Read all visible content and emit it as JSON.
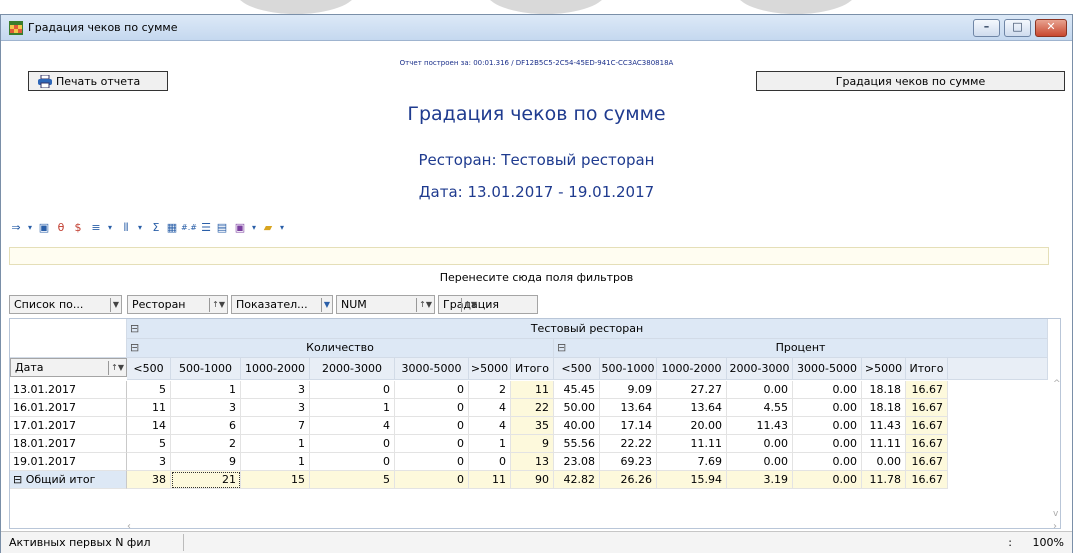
{
  "window": {
    "title": "Градация чеков по сумме",
    "report_info": "Отчет построен за: 00:01.316 / DF12B5C5-2C54-45ED-941C-CC3AC380818A",
    "print_button": "Печать отчета",
    "title_button": "Градация чеков по сумме"
  },
  "report": {
    "heading": "Градация чеков по сумме",
    "restaurant": "Ресторан: Тестовый ресторан",
    "date_range": "Дата: 13.01.2017 - 19.01.2017"
  },
  "pivot": {
    "drop_area_hint": "Перенесите сюда поля фильтров",
    "field_buttons": [
      "Список по...",
      "Ресторан",
      "Показател...",
      "NUM",
      "Градация"
    ],
    "restaurant_header": "Тестовый ресторан",
    "group_headers": [
      "Количество",
      "Процент"
    ],
    "row_field": "Дата",
    "column_headers": [
      "<500",
      "500-1000",
      "1000-2000",
      "2000-3000",
      "3000-5000",
      ">5000",
      "Итого",
      "<500",
      "500-1000",
      "1000-2000",
      "2000-3000",
      "3000-5000",
      ">5000",
      "Итого"
    ],
    "rows": [
      {
        "label": "13.01.2017",
        "values": [
          "5",
          "1",
          "3",
          "0",
          "0",
          "2",
          "11",
          "45.45",
          "9.09",
          "27.27",
          "0.00",
          "0.00",
          "18.18",
          "16.67"
        ]
      },
      {
        "label": "16.01.2017",
        "values": [
          "11",
          "3",
          "3",
          "1",
          "0",
          "4",
          "22",
          "50.00",
          "13.64",
          "13.64",
          "4.55",
          "0.00",
          "18.18",
          "16.67"
        ]
      },
      {
        "label": "17.01.2017",
        "values": [
          "14",
          "6",
          "7",
          "4",
          "0",
          "4",
          "35",
          "40.00",
          "17.14",
          "20.00",
          "11.43",
          "0.00",
          "11.43",
          "16.67"
        ]
      },
      {
        "label": "18.01.2017",
        "values": [
          "5",
          "2",
          "1",
          "0",
          "0",
          "1",
          "9",
          "55.56",
          "22.22",
          "11.11",
          "0.00",
          "0.00",
          "11.11",
          "16.67"
        ]
      },
      {
        "label": "19.01.2017",
        "values": [
          "3",
          "9",
          "1",
          "0",
          "0",
          "0",
          "13",
          "23.08",
          "69.23",
          "7.69",
          "0.00",
          "0.00",
          "0.00",
          "16.67"
        ]
      }
    ],
    "grand_total": {
      "label": "Общий итог",
      "values": [
        "38",
        "21",
        "15",
        "5",
        "0",
        "11",
        "90",
        "42.82",
        "26.26",
        "15.94",
        "3.19",
        "0.00",
        "11.78",
        "16.67"
      ]
    }
  },
  "statusbar": {
    "left_text": "Активных первых N фил",
    "right_colon": ":",
    "zoom": "100%"
  },
  "colors": {
    "heading": "#1f3b8f",
    "header_bg": "#e8eef6",
    "total_bg": "#fdf9dc"
  }
}
